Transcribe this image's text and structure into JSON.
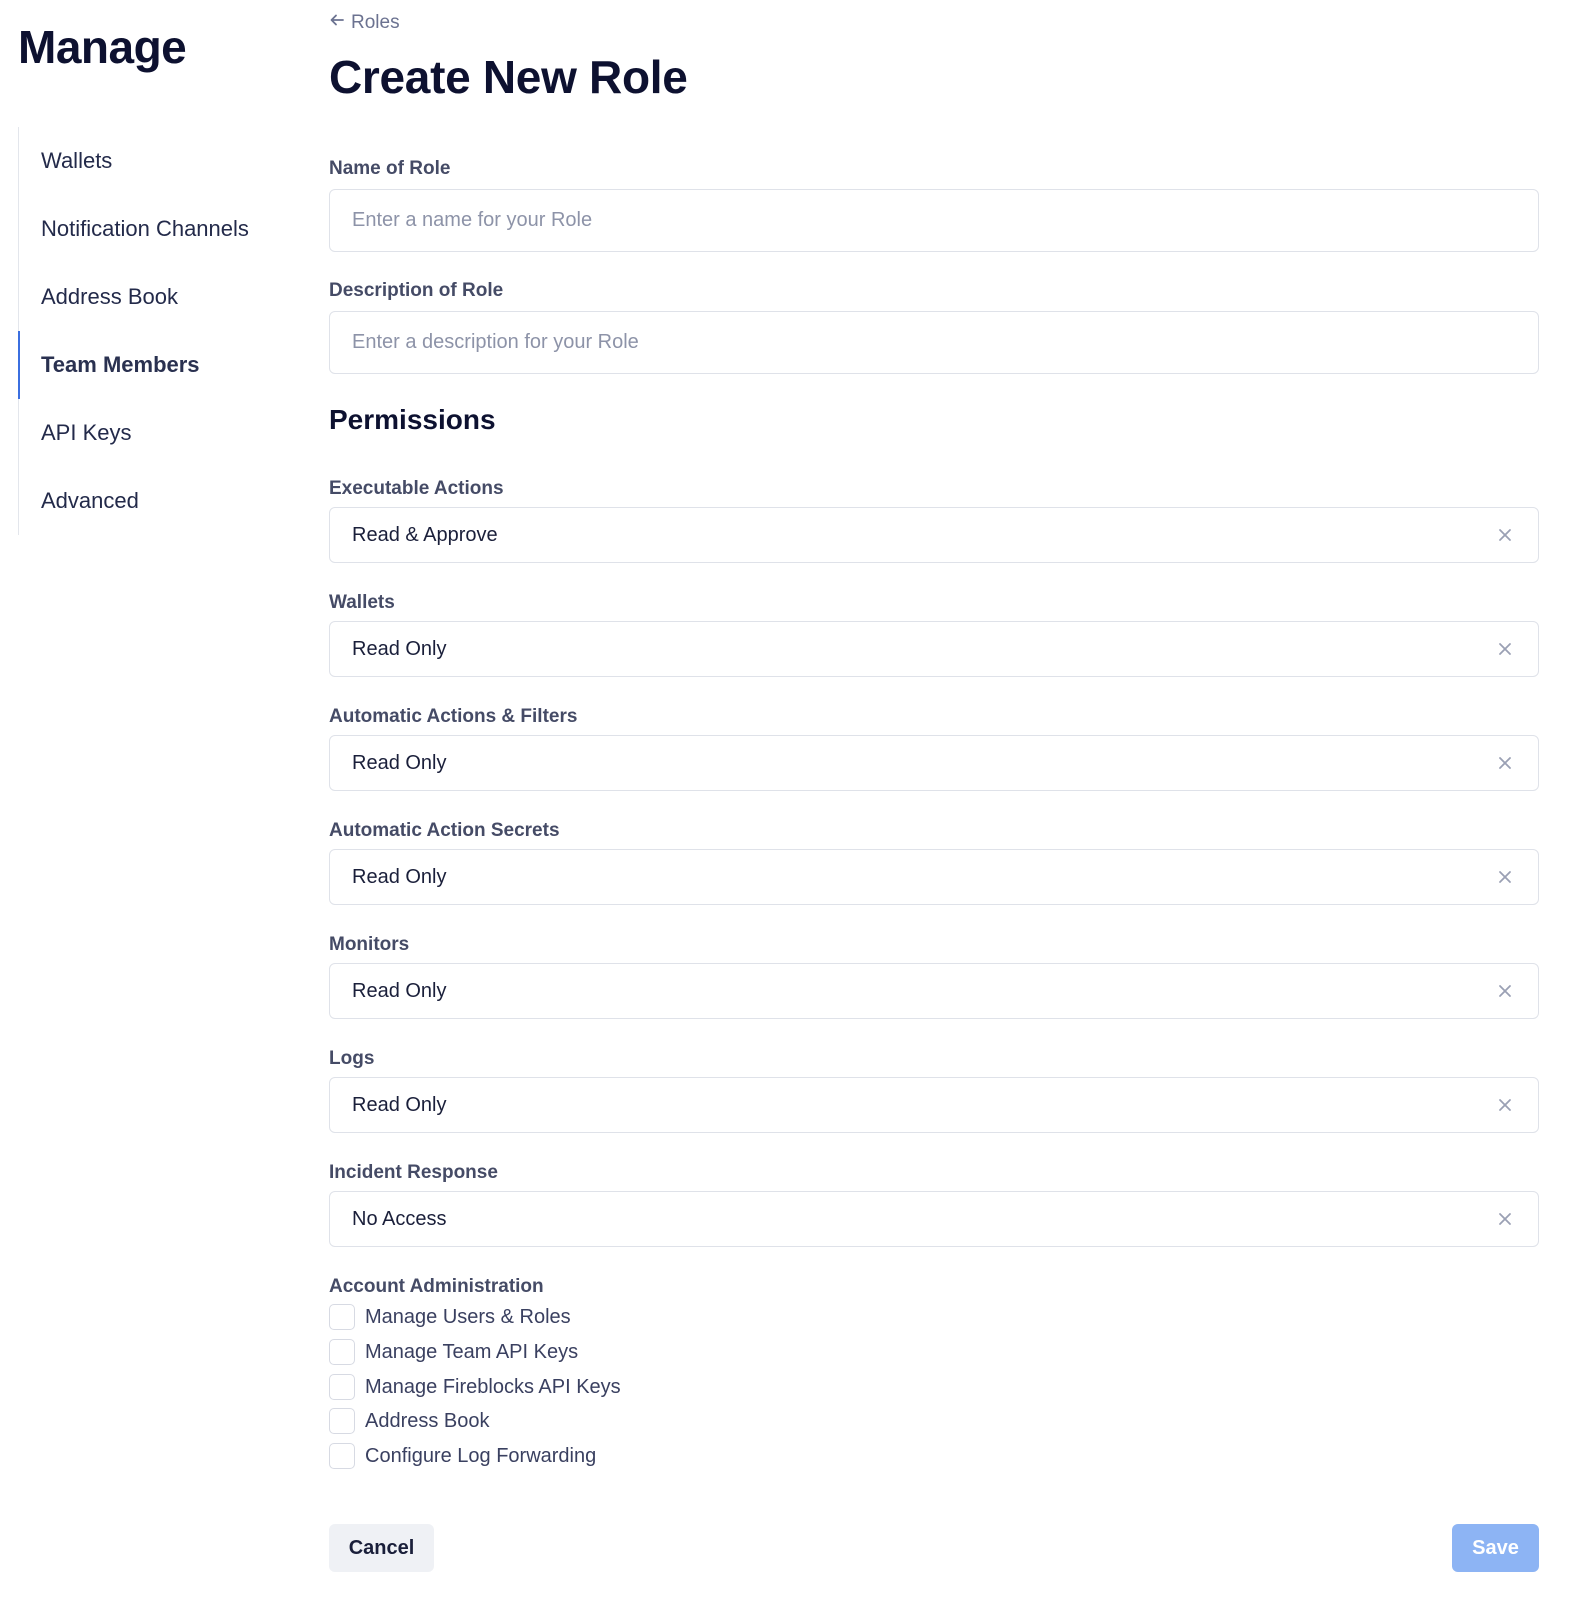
{
  "sidebar": {
    "title": "Manage",
    "items": [
      {
        "label": "Wallets"
      },
      {
        "label": "Notification Channels"
      },
      {
        "label": "Address Book"
      },
      {
        "label": "Team Members",
        "active": true
      },
      {
        "label": "API Keys"
      },
      {
        "label": "Advanced"
      }
    ]
  },
  "breadcrumb": {
    "label": "Roles"
  },
  "page": {
    "title": "Create New Role"
  },
  "form": {
    "name": {
      "label": "Name of Role",
      "placeholder": "Enter a name for your Role",
      "value": ""
    },
    "description": {
      "label": "Description of Role",
      "placeholder": "Enter a description for your Role",
      "value": ""
    }
  },
  "permissions": {
    "heading": "Permissions",
    "fields": [
      {
        "label": "Executable Actions",
        "value": "Read & Approve"
      },
      {
        "label": "Wallets",
        "value": "Read Only"
      },
      {
        "label": "Automatic Actions & Filters",
        "value": "Read Only"
      },
      {
        "label": "Automatic Action Secrets",
        "value": "Read Only"
      },
      {
        "label": "Monitors",
        "value": "Read Only"
      },
      {
        "label": "Logs",
        "value": "Read Only"
      },
      {
        "label": "Incident Response",
        "value": "No Access"
      }
    ],
    "account_admin": {
      "label": "Account Administration",
      "options": [
        {
          "label": "Manage Users & Roles",
          "checked": false
        },
        {
          "label": "Manage Team API Keys",
          "checked": false
        },
        {
          "label": "Manage Fireblocks API Keys",
          "checked": false
        },
        {
          "label": "Address Book",
          "checked": false
        },
        {
          "label": "Configure Log Forwarding",
          "checked": false
        }
      ]
    }
  },
  "actions": {
    "cancel_label": "Cancel",
    "save_label": "Save"
  },
  "colors": {
    "accent": "#3b6fe0",
    "save_button": "#8db4f4",
    "title": "#0d1130"
  }
}
